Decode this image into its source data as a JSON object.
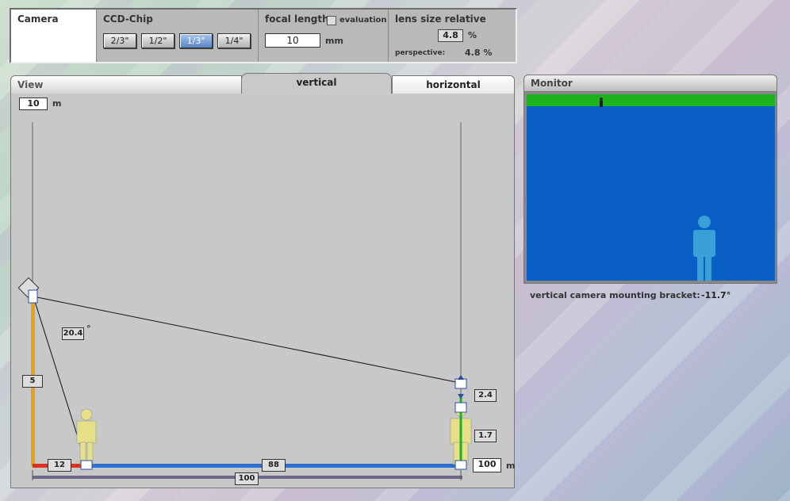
{
  "toolbar": {
    "camera_title": "Camera",
    "ccd_title": "CCD-Chip",
    "chips": [
      {
        "label": "2/3\"",
        "active": false
      },
      {
        "label": "1/2\"",
        "active": false
      },
      {
        "label": "1/3\"",
        "active": true
      },
      {
        "label": "1/4\"",
        "active": false
      }
    ],
    "focal_title": "focal length",
    "focal_value": "10",
    "focal_unit": "mm",
    "evaluation_label": "evaluation",
    "lens_title": "lens size relative",
    "lens_value": "4.8",
    "lens_unit": "%",
    "perspective_label": "perspective:",
    "perspective_value": "4.8 %"
  },
  "tabs": {
    "view": "View",
    "vertical": "vertical",
    "horizontal": "horizontal"
  },
  "scene": {
    "top_distance": "10",
    "top_unit": "m",
    "angle": "20.4",
    "angle_unit": "°",
    "camera_height": "5",
    "near_distance": "12",
    "mid_distance": "88",
    "far_distance": "100",
    "far_unit": "m",
    "total_distance": "100",
    "upper_height": "2.4",
    "person_height": "1.7"
  },
  "monitor": {
    "title": "Monitor",
    "bracket_label": "vertical camera mounting bracket:",
    "bracket_value": "-11.7°"
  },
  "colors": {
    "pole": "#e8a020",
    "ground_near": "#e03020",
    "ground_far": "#2a70d0",
    "monitor_bg": "#0a5fc7",
    "monitor_green": "#1fb21f",
    "person_yellow": "#e6e08a",
    "person_blue": "#3aa0d8"
  }
}
